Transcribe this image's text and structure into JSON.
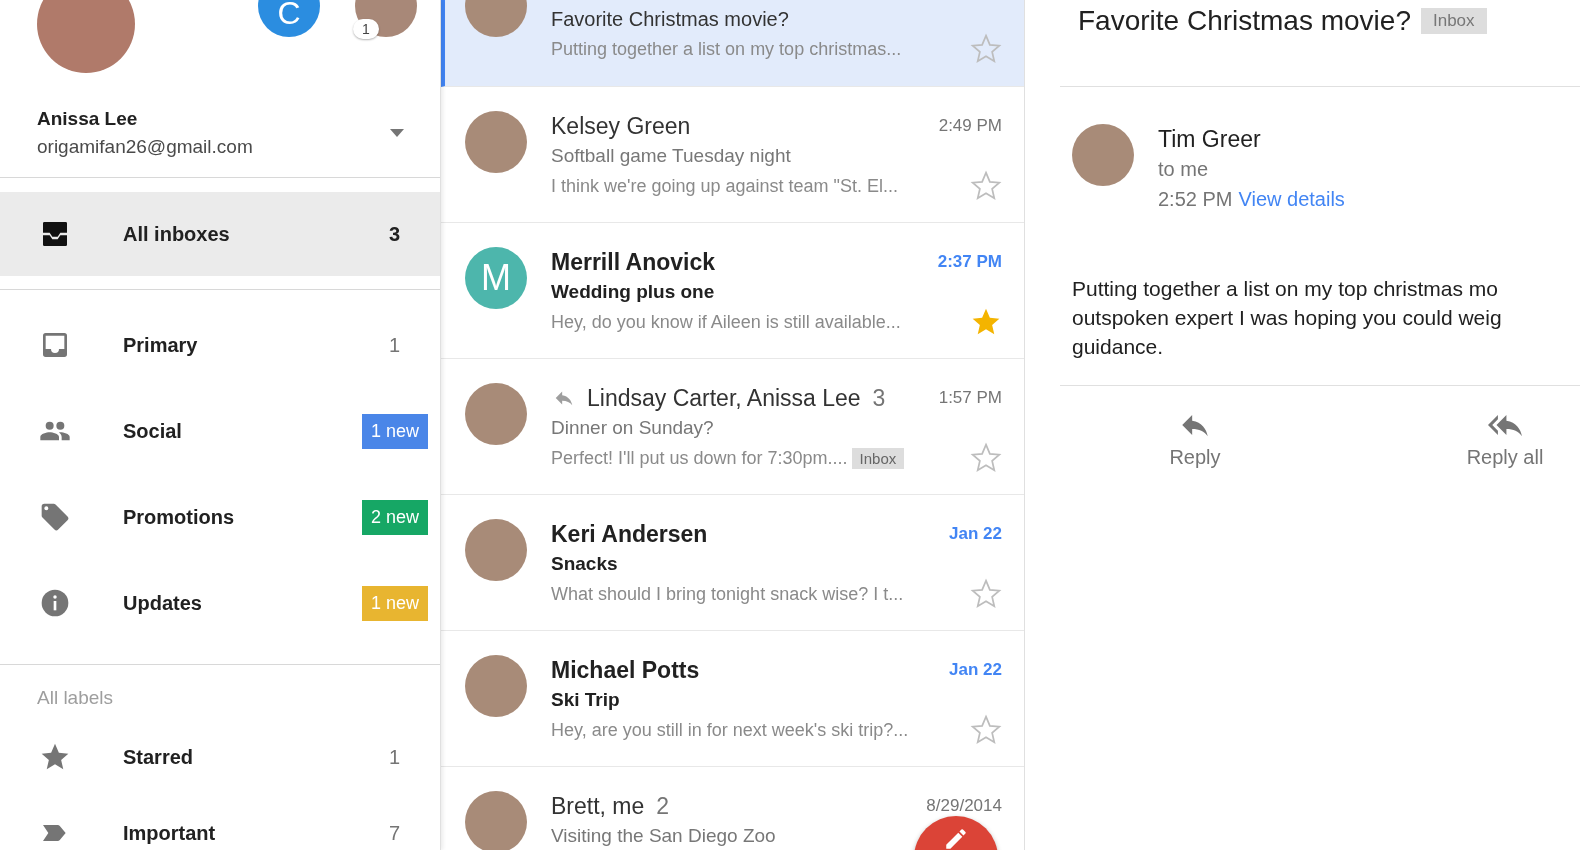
{
  "account": {
    "name": "Anissa Lee",
    "email": "origamifan26@gmail.com",
    "other_accounts": [
      {
        "kind": "letter",
        "initial": "C",
        "color": "#2b8de0"
      },
      {
        "kind": "photo",
        "badge": "1"
      }
    ]
  },
  "nav": [
    {
      "label": "All inboxes",
      "count": "3",
      "selected": true
    },
    {
      "label": "Primary",
      "count": "1",
      "selected": false
    },
    {
      "label": "Social",
      "badge": "1 new",
      "color": "#4a86e8",
      "selected": false
    },
    {
      "label": "Promotions",
      "badge": "2 new",
      "color": "#16a765",
      "selected": false
    },
    {
      "label": "Updates",
      "badge": "1 new",
      "color": "#e8b530",
      "selected": false
    }
  ],
  "labels_heading": "All labels",
  "labels": [
    {
      "label": "Starred",
      "count": "1",
      "selected": false
    },
    {
      "label": "Important",
      "count": "7",
      "selected": false
    }
  ],
  "messages": [
    {
      "avatar": {
        "kind": "photo"
      },
      "subject": "Favorite Christmas movie?",
      "preview": "Putting together a list on my top christmas...",
      "starred": false,
      "unread": false,
      "selected": true
    },
    {
      "avatar": {
        "kind": "photo"
      },
      "sender": "Kelsey Green",
      "time": "2:49 PM",
      "subject": "Softball game Tuesday night",
      "preview": "I think we're going up against team \"St. El...",
      "starred": false,
      "unread": false,
      "selected": false
    },
    {
      "avatar": {
        "kind": "letter",
        "initial": "M",
        "color": "#4db6ac"
      },
      "sender": "Merrill Anovick",
      "time": "2:37 PM",
      "subject": "Wedding plus one",
      "preview": "Hey, do you know if Aileen is still available...",
      "starred": true,
      "unread": true,
      "selected": false
    },
    {
      "avatar": {
        "kind": "photo"
      },
      "replied": true,
      "sender": "Lindsay Carter, Anissa Lee",
      "thread_count": "3",
      "time": "1:57 PM",
      "subject": "Dinner on Sunday?",
      "preview": "Perfect! I'll put us down for 7:30pm....",
      "label": "Inbox",
      "starred": false,
      "unread": false,
      "selected": false
    },
    {
      "avatar": {
        "kind": "photo"
      },
      "sender": "Keri Andersen",
      "time": "Jan 22",
      "subject": "Snacks",
      "preview": "What should I bring tonight snack wise? I t...",
      "starred": false,
      "unread": true,
      "selected": false
    },
    {
      "avatar": {
        "kind": "photo"
      },
      "sender": "Michael Potts",
      "time": "Jan 22",
      "subject": "Ski Trip",
      "preview": "Hey, are you still in for next week's ski trip?...",
      "starred": false,
      "unread": true,
      "selected": false
    },
    {
      "avatar": {
        "kind": "photo"
      },
      "sender": "Brett, me",
      "thread_count": "2",
      "time": "8/29/2014",
      "subject": "Visiting the San Diego Zoo",
      "unread": false,
      "selected": false
    }
  ],
  "reading_pane": {
    "subject": "Favorite Christmas movie?",
    "label": "Inbox",
    "sender": "Tim Greer",
    "recipient": "to me",
    "time": "2:52 PM",
    "details_link": "View details",
    "body_lines": [
      "Putting together a list on my top christmas mo",
      "outspoken expert I was hoping you could weig",
      "guidance."
    ],
    "actions": [
      {
        "kind": "reply",
        "label": "Reply"
      },
      {
        "kind": "reply_all",
        "label": "Reply all"
      }
    ]
  }
}
